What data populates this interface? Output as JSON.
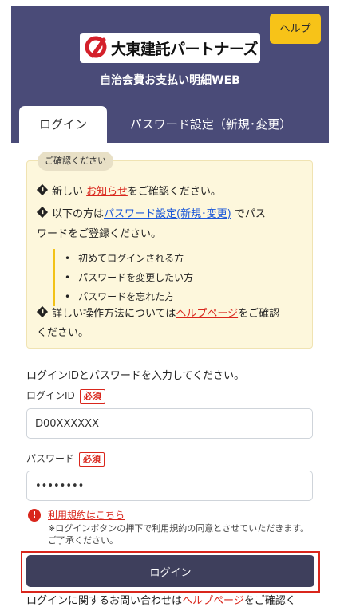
{
  "header": {
    "help_label": "ヘルプ",
    "logo_text": "大東建託パートナーズ",
    "app_title": "自治会費お支払い明細WEB"
  },
  "tabs": [
    {
      "label": "ログイン",
      "active": true
    },
    {
      "label": "パスワード設定（新規･変更）",
      "active": false
    }
  ],
  "notice": {
    "label": "ご確認ください",
    "line1_pre": "新しい",
    "line1_link": "お知らせ",
    "line1_post": "をご確認ください。",
    "line2_pre": "以下の方は",
    "line2_link": "パスワード設定(新規･変更)",
    "line2_post": "でパス",
    "line2_cont": "ワードをご登録ください。",
    "bullets": [
      "初めてログインされる方",
      "パスワードを変更したい方",
      "パスワードを忘れた方"
    ],
    "line3_pre": "詳しい操作方法については",
    "line3_link": "ヘルプページ",
    "line3_post": "をご確認",
    "line3_cont": "ください。"
  },
  "form": {
    "instruction": "ログインIDとパスワードを入力してください。",
    "id_label": "ログインID",
    "required": "必須",
    "id_value": "D00XXXXXX",
    "password_label": "パスワード",
    "password_value": "********",
    "terms_link": "利用規約はこちら",
    "terms_note": "※ログインボタンの押下で利用規約の同意とさせていただきます。ご了承ください。",
    "login_button": "ログイン"
  },
  "footer": {
    "contact_pre": "ログインに関するお問い合わせは",
    "contact_link": "ヘルプページ",
    "contact_post": "をご確認く"
  },
  "colors": {
    "header_bg": "#4a4b78",
    "help_button": "#f7c318",
    "notice_bg": "#fdf7dc",
    "required": "#d9261c",
    "login_button": "#3e3f5c",
    "link_blue": "#1a57d8",
    "link_red": "#d9261c"
  }
}
